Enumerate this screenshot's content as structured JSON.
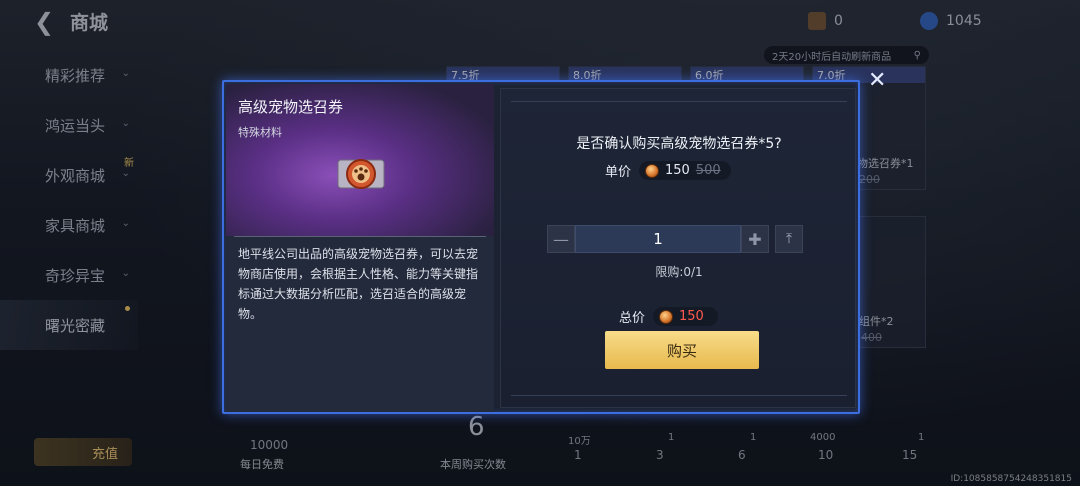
{
  "header": {
    "back_icon": "arrow-left-icon",
    "title": "商城",
    "currency1": "0",
    "currency2": "1045",
    "refresh_text": "2天20小时后自动刷新商品"
  },
  "sidebar": {
    "items": [
      {
        "label": "精彩推荐",
        "chevron": "⌄"
      },
      {
        "label": "鸿运当头",
        "chevron": "⌄"
      },
      {
        "label": "外观商城",
        "chevron": "⌄",
        "badge": "新"
      },
      {
        "label": "家具商城",
        "chevron": "⌄"
      },
      {
        "label": "奇珍异宝",
        "chevron": "⌄"
      },
      {
        "label": "曙光密藏"
      }
    ],
    "recharge": "充值"
  },
  "bg_cards": [
    {
      "discount": "7.5折"
    },
    {
      "discount": "8.0折"
    },
    {
      "discount": "6.0折"
    },
    {
      "discount": "7.0折"
    }
  ],
  "bg_labels": {
    "card_name_1": "物选召券*1",
    "card_price_1": "200",
    "card_name_2": "组件*2",
    "card_price_2": "400"
  },
  "bottom": {
    "free_value": "10000",
    "free_label": "每日免费",
    "weekly_count": "6",
    "weekly_label": "本周购买次数",
    "rewards": [
      "10万",
      "1",
      "1",
      "4000",
      "1"
    ],
    "milestones": [
      "1",
      "3",
      "6",
      "10",
      "15"
    ]
  },
  "watermark": "ID:1085858754248351815",
  "dialog": {
    "item_name": "高级宠物选召券",
    "item_type": "特殊材料",
    "description": "地平线公司出品的高级宠物选召券，可以去宠物商店使用，会根据主人性格、能力等关键指标通过大数据分析匹配，选召适合的高级宠物。",
    "confirm_text": "是否确认购买高级宠物选召券*5?",
    "unit_price_label": "单价",
    "unit_price": "150",
    "original_price": "500",
    "quantity": "1",
    "limit_text": "限购:0/1",
    "total_label": "总价",
    "total_price": "150",
    "buy_label": "购买",
    "close_icon": "close-icon",
    "minus_icon": "minus-icon",
    "plus_icon": "plus-icon",
    "max_icon": "max-icon"
  },
  "colors": {
    "dialog_border": "#3c6ee0",
    "buy_button": "#e7b94d",
    "total_price": "#ff5a4d"
  }
}
